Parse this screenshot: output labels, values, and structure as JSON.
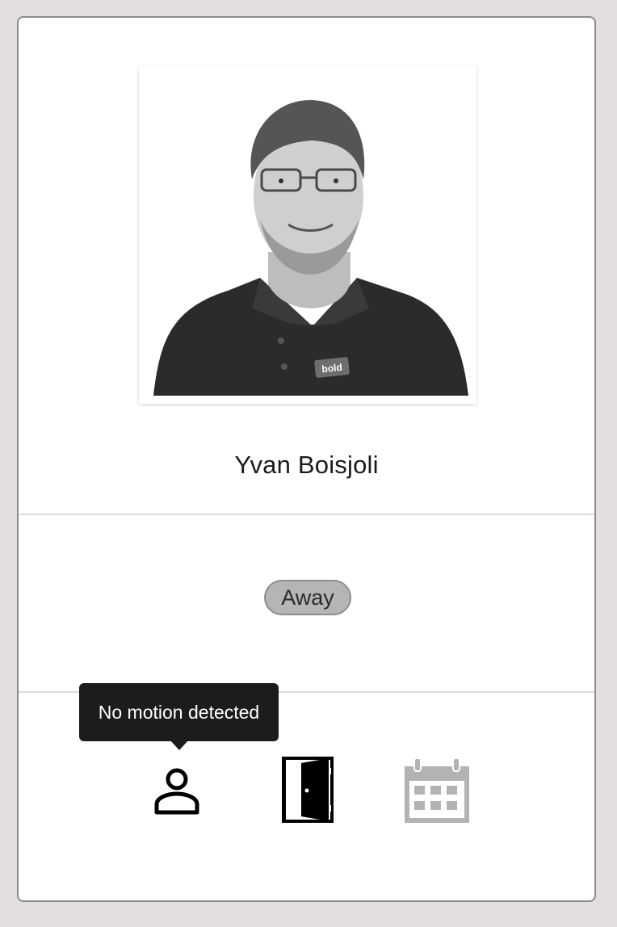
{
  "profile": {
    "name": "Yvan Boisjoli",
    "photo_alt": "Yvan Boisjoli",
    "shirt_logo_text": "bold"
  },
  "status": {
    "label": "Away",
    "color": "#b5b5b5"
  },
  "tooltip": {
    "text": "No motion detected"
  },
  "icons": [
    {
      "name": "person-icon",
      "color": "#000000"
    },
    {
      "name": "door-open-icon",
      "color": "#000000"
    },
    {
      "name": "calendar-icon",
      "color": "#b3b3b3"
    }
  ]
}
